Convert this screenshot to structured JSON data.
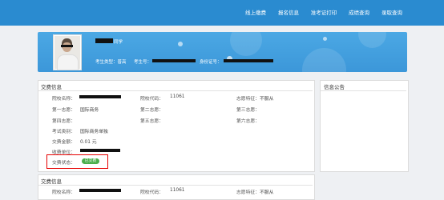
{
  "nav": {
    "items": [
      "线上缴费",
      "报名信息",
      "准考证打印",
      "成绩查询",
      "录取查询"
    ]
  },
  "banner": {
    "greeting": "同学",
    "exam_type_label": "考生类型：普高",
    "candidate_no_label": "考生号：",
    "id_no_label": "身份证号："
  },
  "payment": {
    "title": "交费信息",
    "school_name_label": "院校名称：",
    "school_code_label": "院校代码：",
    "school_code": "11061",
    "special_label": "志愿特征：",
    "special_value": "不服从",
    "choice1_label": "第一志愿：",
    "choice1_value": "国际商务",
    "choice2_label": "第二志愿：",
    "choice3_label": "第三志愿：",
    "choice4_label": "第四志愿：",
    "choice5_label": "第五志愿：",
    "choice6_label": "第六志愿：",
    "category_label": "考试类别：",
    "category_value": "国际商务单独",
    "amount_label": "交费金额：",
    "amount_value": "0.01 元",
    "payee_label": "收费单位：",
    "status_label": "交费状态：",
    "status_value": "已交费"
  },
  "notice": {
    "title": "信息公告"
  },
  "payment2": {
    "title": "交费信息",
    "school_name_label": "院校名称：",
    "school_code_label": "院校代码：",
    "school_code": "11061",
    "special_label": "志愿特征：",
    "special_value": "不服从"
  },
  "colors": {
    "topbar": "#2a8bd0",
    "banner": "#3c97d9",
    "status_badge": "#4cae4c",
    "highlight": "#e60000"
  }
}
